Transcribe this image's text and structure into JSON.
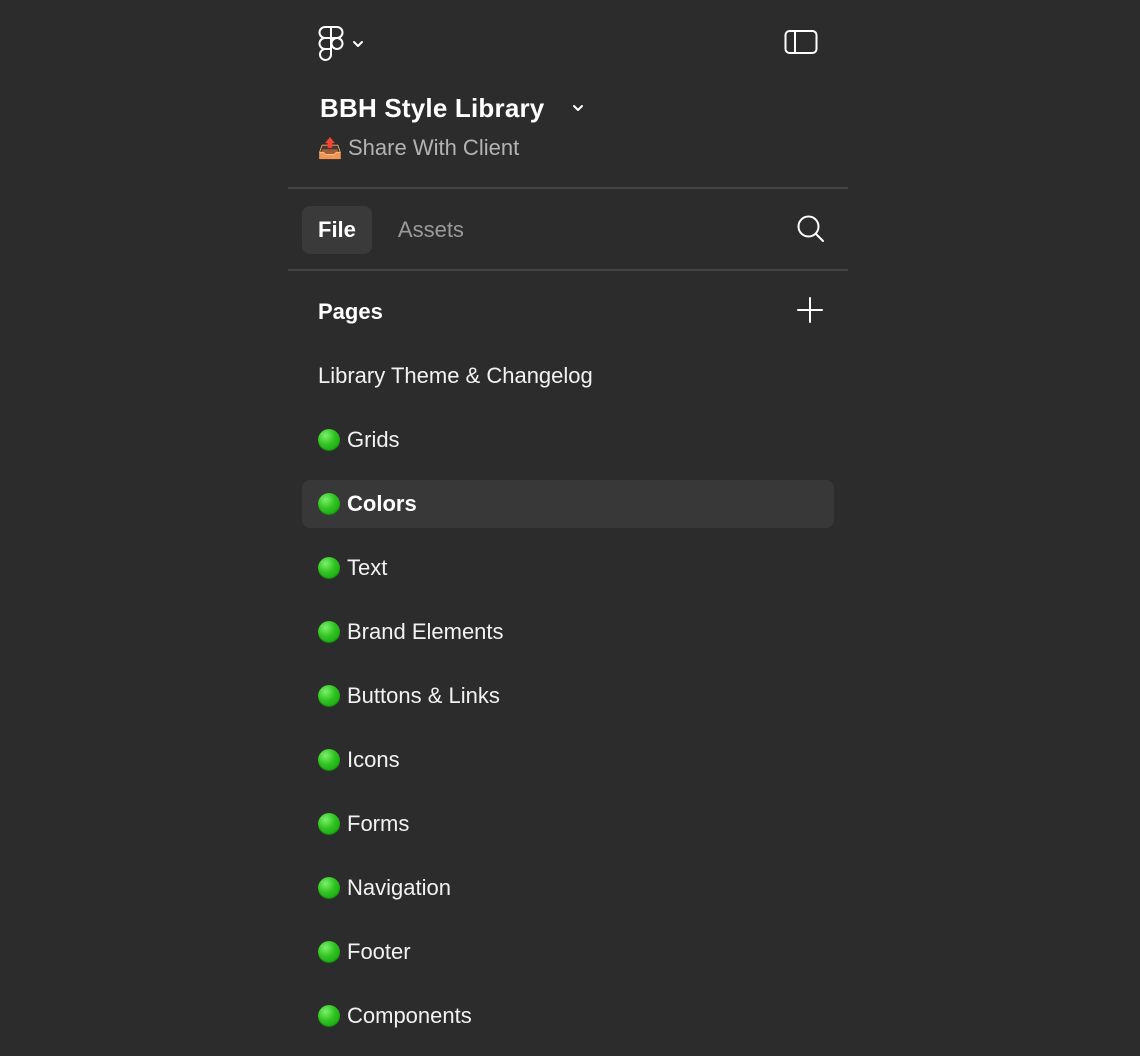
{
  "header": {
    "logo_icon": "figma-logo-icon",
    "menu_chevron_icon": "chevron-down-icon",
    "sidebar_toggle_icon": "sidebar-panel-icon"
  },
  "file": {
    "title": "BBH Style Library",
    "title_chevron_icon": "chevron-down-icon",
    "project_emoji": "📤",
    "project_name": "Share With Client"
  },
  "tabs": [
    {
      "label": "File",
      "active": true
    },
    {
      "label": "Assets",
      "active": false
    }
  ],
  "search_icon": "search-icon",
  "pages": {
    "header_label": "Pages",
    "add_icon": "plus-icon",
    "items": [
      {
        "label": "Library Theme & Changelog",
        "status_dot": false,
        "selected": false
      },
      {
        "label": "Grids",
        "status_dot": true,
        "selected": false
      },
      {
        "label": "Colors",
        "status_dot": true,
        "selected": true
      },
      {
        "label": "Text",
        "status_dot": true,
        "selected": false
      },
      {
        "label": "Brand Elements",
        "status_dot": true,
        "selected": false
      },
      {
        "label": "Buttons & Links",
        "status_dot": true,
        "selected": false
      },
      {
        "label": "Icons",
        "status_dot": true,
        "selected": false
      },
      {
        "label": "Forms",
        "status_dot": true,
        "selected": false
      },
      {
        "label": "Navigation",
        "status_dot": true,
        "selected": false
      },
      {
        "label": "Footer",
        "status_dot": true,
        "selected": false
      },
      {
        "label": "Components",
        "status_dot": true,
        "selected": false
      }
    ]
  },
  "colors": {
    "background": "#2c2c2c",
    "selected_row": "#383838",
    "status_green": "#2ec21f",
    "muted_text": "#b3b3b3"
  }
}
